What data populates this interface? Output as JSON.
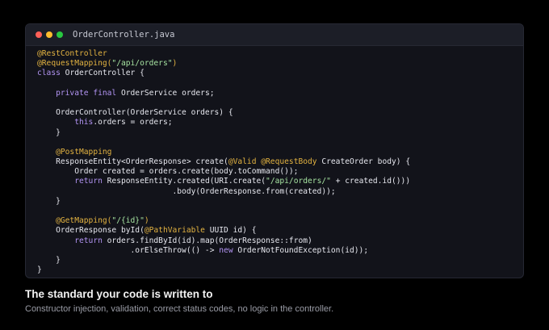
{
  "colors": {
    "window_close": "#ff5f57",
    "window_minimize": "#febc2e",
    "window_maximize": "#28c840",
    "annotation": "#e3b341",
    "keyword": "#b294f3",
    "string": "#a6e3a1",
    "plain": "#e6e7ee"
  },
  "editor": {
    "filename": "OrderController.java",
    "lines": [
      [
        {
          "t": "a",
          "v": "@RestController"
        }
      ],
      [
        {
          "t": "a",
          "v": "@RequestMapping("
        },
        {
          "t": "s",
          "v": "\"/api/orders\""
        },
        {
          "t": "a",
          "v": ")"
        }
      ],
      [
        {
          "t": "k",
          "v": "class"
        },
        {
          "t": "p",
          "v": " OrderController {"
        }
      ],
      [],
      [
        {
          "t": "p",
          "v": "    "
        },
        {
          "t": "k",
          "v": "private final"
        },
        {
          "t": "p",
          "v": " OrderService orders;"
        }
      ],
      [],
      [
        {
          "t": "p",
          "v": "    OrderController(OrderService orders) {"
        }
      ],
      [
        {
          "t": "p",
          "v": "        "
        },
        {
          "t": "k",
          "v": "this"
        },
        {
          "t": "p",
          "v": ".orders = orders;"
        }
      ],
      [
        {
          "t": "p",
          "v": "    }"
        }
      ],
      [],
      [
        {
          "t": "p",
          "v": "    "
        },
        {
          "t": "a",
          "v": "@PostMapping"
        }
      ],
      [
        {
          "t": "p",
          "v": "    ResponseEntity<OrderResponse> create("
        },
        {
          "t": "a",
          "v": "@Valid @RequestBody"
        },
        {
          "t": "p",
          "v": " CreateOrder body) {"
        }
      ],
      [
        {
          "t": "p",
          "v": "        Order created = orders.create(body.toCommand());"
        }
      ],
      [
        {
          "t": "p",
          "v": "        "
        },
        {
          "t": "k",
          "v": "return"
        },
        {
          "t": "p",
          "v": " ResponseEntity.created(URI.create("
        },
        {
          "t": "s",
          "v": "\"/api/orders/\""
        },
        {
          "t": "p",
          "v": " + created.id()))"
        }
      ],
      [
        {
          "t": "p",
          "v": "                             .body(OrderResponse.from(created));"
        }
      ],
      [
        {
          "t": "p",
          "v": "    }"
        }
      ],
      [],
      [
        {
          "t": "p",
          "v": "    "
        },
        {
          "t": "a",
          "v": "@GetMapping("
        },
        {
          "t": "s",
          "v": "\"/{id}\""
        },
        {
          "t": "a",
          "v": ")"
        }
      ],
      [
        {
          "t": "p",
          "v": "    OrderResponse byId("
        },
        {
          "t": "a",
          "v": "@PathVariable"
        },
        {
          "t": "p",
          "v": " UUID id) {"
        }
      ],
      [
        {
          "t": "p",
          "v": "        "
        },
        {
          "t": "k",
          "v": "return"
        },
        {
          "t": "p",
          "v": " orders.findById(id).map(OrderResponse::from)"
        }
      ],
      [
        {
          "t": "p",
          "v": "                    .orElseThrow(() -> "
        },
        {
          "t": "k",
          "v": "new"
        },
        {
          "t": "p",
          "v": " OrderNotFoundException(id));"
        }
      ],
      [
        {
          "t": "p",
          "v": "    }"
        }
      ],
      [
        {
          "t": "p",
          "v": "}"
        }
      ]
    ]
  },
  "caption": {
    "title": "The standard your code is written to",
    "subtitle": "Constructor injection, validation, correct status codes, no logic in the controller."
  }
}
